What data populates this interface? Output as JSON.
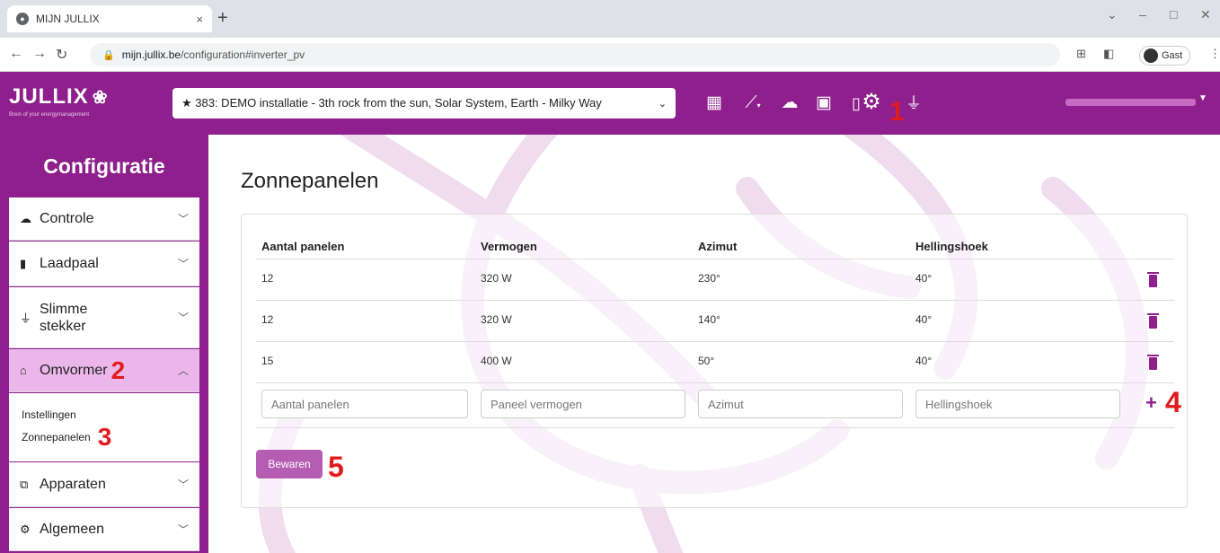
{
  "browser": {
    "tab_title": "MIJN JULLIX",
    "tab_close": "×",
    "new_tab": "+",
    "url_host": "mijn.jullix.be",
    "url_path": "/configuration#inverter_pv",
    "profile_label": "Gast"
  },
  "header": {
    "logo_text": "JULLIX",
    "logo_tagline": "Brein of your energymanagement",
    "installation": "★  383: DEMO installatie - 3th rock from the sun, Solar System, Earth - Milky Way",
    "icons": [
      "dashboard-icon",
      "chart-icon",
      "brain-icon",
      "money-icon",
      "charger-icon",
      "plug-icon",
      "gear-icon"
    ]
  },
  "sidebar": {
    "title": "Configuratie",
    "items": [
      {
        "label": "Controle",
        "icon": "brain-icon"
      },
      {
        "label": "Laadpaal",
        "icon": "charger-icon"
      },
      {
        "label": "Slimme stekker",
        "icon": "plug-icon"
      },
      {
        "label": "Omvormer",
        "icon": "inverter-icon",
        "active": true
      },
      {
        "label": "Apparaten",
        "icon": "devices-icon"
      },
      {
        "label": "Algemeen",
        "icon": "gear-icon"
      }
    ],
    "sub_items": [
      "Instellingen",
      "Zonnepanelen"
    ]
  },
  "main": {
    "title": "Zonnepanelen",
    "columns": [
      "Aantal panelen",
      "Vermogen",
      "Azimut",
      "Hellingshoek"
    ],
    "rows": [
      [
        "12",
        "320 W",
        "230°",
        "40°"
      ],
      [
        "12",
        "320 W",
        "140°",
        "40°"
      ],
      [
        "15",
        "400 W",
        "50°",
        "40°"
      ]
    ],
    "placeholders": [
      "Aantal panelen",
      "Paneel vermogen",
      "Azimut",
      "Hellingshoek"
    ],
    "add_label": "+",
    "save_label": "Bewaren"
  },
  "annotations": [
    "1",
    "2",
    "3",
    "4",
    "5"
  ],
  "colors": {
    "brand": "#8e1f8c",
    "active": "#ebb7eb",
    "annotation": "#e01b1b"
  }
}
